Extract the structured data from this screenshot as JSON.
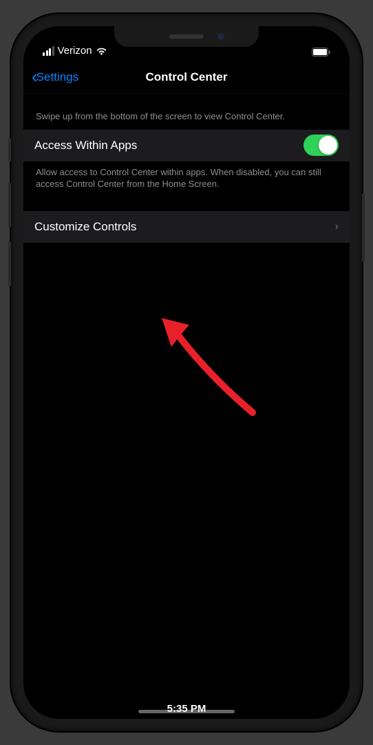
{
  "statusBar": {
    "carrier": "Verizon",
    "time": "5:35 PM"
  },
  "navBar": {
    "backLabel": "Settings",
    "title": "Control Center"
  },
  "section1": {
    "header": "Swipe up from the bottom of the screen to view Control Center.",
    "accessWithinApps": {
      "label": "Access Within Apps",
      "enabled": true
    },
    "footer": "Allow access to Control Center within apps. When disabled, you can still access Control Center from the Home Screen."
  },
  "section2": {
    "customizeControls": {
      "label": "Customize Controls"
    }
  }
}
